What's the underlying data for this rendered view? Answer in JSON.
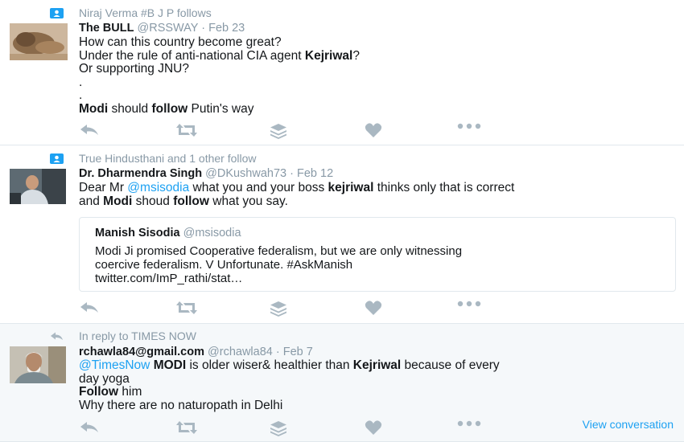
{
  "tweets": [
    {
      "context": "Niraj Verma #B J P follows",
      "context_icon": "person-follow-icon",
      "name": "The BULL",
      "handle": "@RSSWAY",
      "date": "Feb 23",
      "lines": [
        {
          "parts": [
            {
              "t": "How can this country become great?"
            }
          ]
        },
        {
          "parts": [
            {
              "t": "Under the rule of anti-national CIA agent "
            },
            {
              "t": "Kejriwal",
              "b": true
            },
            {
              "t": "?"
            }
          ]
        },
        {
          "parts": [
            {
              "t": "Or supporting JNU?"
            }
          ]
        },
        {
          "parts": [
            {
              "t": "."
            }
          ]
        },
        {
          "parts": [
            {
              "t": "."
            }
          ]
        },
        {
          "parts": [
            {
              "t": "Modi",
              "b": true
            },
            {
              "t": " should "
            },
            {
              "t": "follow",
              "b": true
            },
            {
              "t": " Putin's way"
            }
          ]
        }
      ]
    },
    {
      "context": "True Hindusthani and 1 other follow",
      "context_icon": "person-follow-icon",
      "name": "Dr. Dharmendra Singh",
      "handle": "@DKushwah73",
      "date": "Feb 12",
      "lines": [
        {
          "parts": [
            {
              "t": "Dear Mr "
            },
            {
              "t": "@msisodia",
              "m": true
            },
            {
              "t": " what you and your boss "
            },
            {
              "t": "kejriwal",
              "b": true
            },
            {
              "t": " thinks only that is correct"
            }
          ]
        },
        {
          "parts": [
            {
              "t": "and "
            },
            {
              "t": "Modi",
              "b": true
            },
            {
              "t": " shoud "
            },
            {
              "t": "follow",
              "b": true
            },
            {
              "t": " what you say."
            }
          ]
        }
      ],
      "quote": {
        "name": "Manish Sisodia",
        "handle": "@msisodia",
        "lines": [
          "Modi Ji promised Cooperative federalism, but we are only witnessing",
          "coercive federalism. V Unfortunate. #AskManish",
          "twitter.com/ImP_rathi/stat…"
        ]
      }
    },
    {
      "context": "In reply to TIMES NOW",
      "context_icon": "reply-icon",
      "name": "rchawla84@gmail.com",
      "handle": "@rchawla84",
      "date": "Feb 7",
      "lines": [
        {
          "parts": [
            {
              "t": "@TimesNow",
              "m": true
            },
            {
              "t": " "
            },
            {
              "t": "MODI",
              "b": true
            },
            {
              "t": " is older wiser& healthier than "
            },
            {
              "t": "Kejriwal",
              "b": true
            },
            {
              "t": " because of every"
            }
          ]
        },
        {
          "parts": [
            {
              "t": "day yoga"
            }
          ]
        },
        {
          "parts": [
            {
              "t": "Follow",
              "b": true
            },
            {
              "t": " him"
            }
          ]
        },
        {
          "parts": [
            {
              "t": "Why there are no naturopath in Delhi"
            }
          ]
        }
      ],
      "view_conversation": "View conversation"
    }
  ],
  "colors": {
    "icon_gray": "#aab8c2",
    "link_blue": "#1da1f2",
    "follow_icon_blue": "#1da1f2"
  }
}
